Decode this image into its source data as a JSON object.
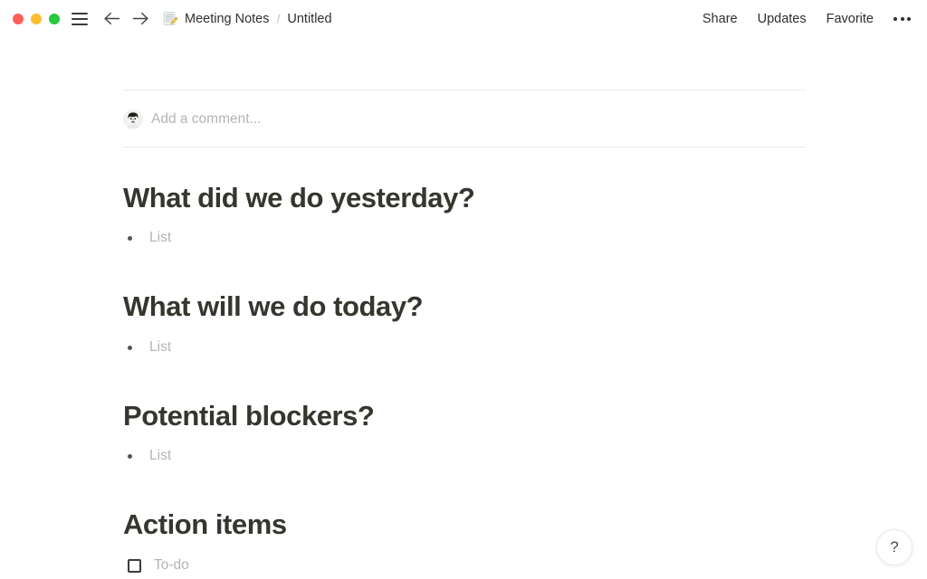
{
  "window": {
    "traffic_lights": [
      {
        "name": "close",
        "color": "#ff5f57"
      },
      {
        "name": "minimize",
        "color": "#febc2e"
      },
      {
        "name": "maximize",
        "color": "#28c840"
      }
    ],
    "menu_icon": "hamburger-menu-icon",
    "back_icon": "arrow-left-icon",
    "forward_icon": "arrow-right-icon"
  },
  "breadcrumb": {
    "doc_emoji": "memo-icon",
    "workspace": "Meeting Notes",
    "separator": "/",
    "page": "Untitled"
  },
  "titlebar_actions": {
    "share": "Share",
    "updates": "Updates",
    "favorite": "Favorite",
    "more": "more-options-icon"
  },
  "comment": {
    "avatar": "user-avatar",
    "placeholder": "Add a comment..."
  },
  "document": {
    "clipped_top_text": "",
    "sections": [
      {
        "heading": "What did we do yesterday?",
        "item_type": "bullet",
        "item_text": "List"
      },
      {
        "heading": "What will we do today?",
        "item_type": "bullet",
        "item_text": "List"
      },
      {
        "heading": "Potential blockers?",
        "item_type": "bullet",
        "item_text": "List"
      },
      {
        "heading": "Action items",
        "item_type": "todo",
        "item_text": "To-do"
      }
    ]
  },
  "help": {
    "label": "?"
  },
  "colors": {
    "text_primary": "#37352f",
    "text_placeholder": "#b4b4b2",
    "divider": "#eaeaea",
    "background": "#ffffff"
  }
}
